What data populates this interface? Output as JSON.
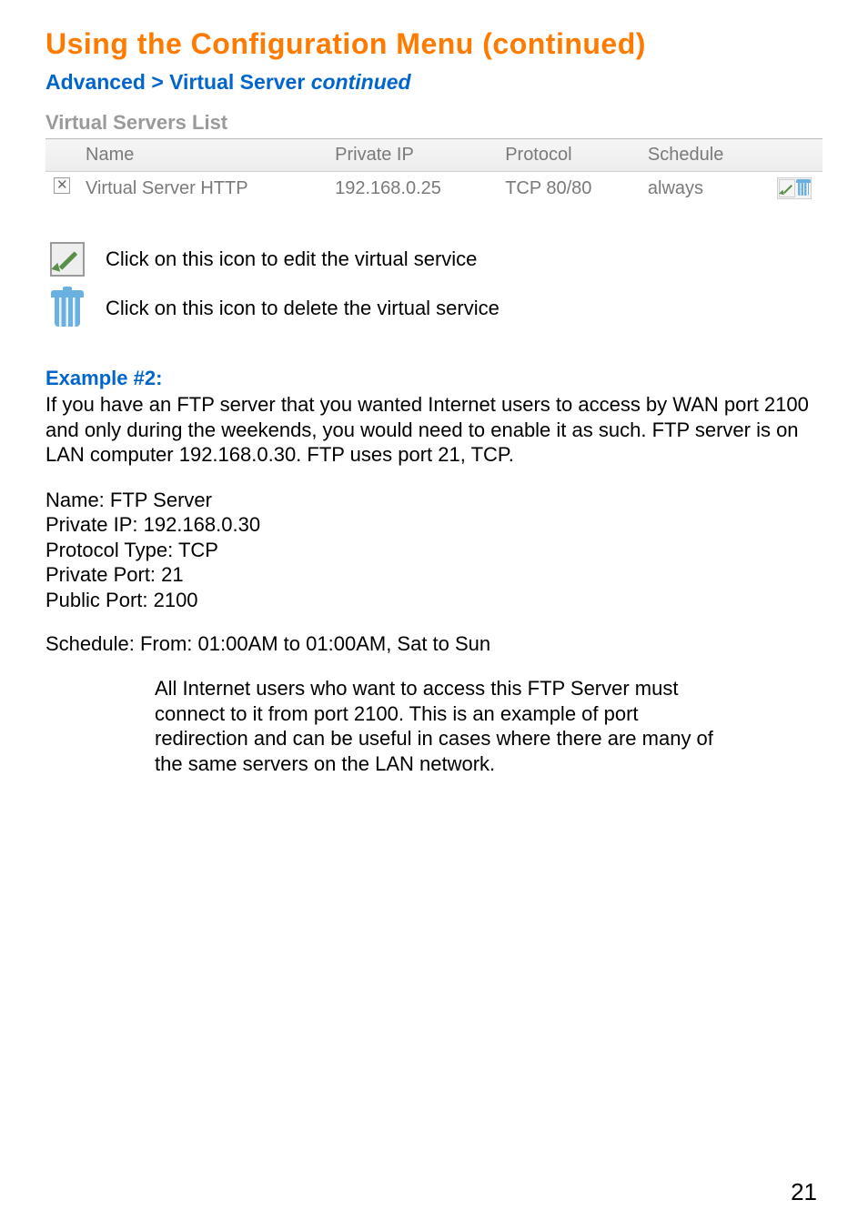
{
  "title": "Using the Configuration Menu (continued)",
  "breadcrumb": {
    "path": "Advanced > Virtual Server ",
    "suffix": "continued"
  },
  "vs_list": {
    "heading": "Virtual Servers List",
    "headers": {
      "name": "Name",
      "private_ip": "Private IP",
      "protocol": "Protocol",
      "schedule": "Schedule"
    },
    "rows": [
      {
        "checked": true,
        "name": "Virtual Server HTTP",
        "private_ip": "192.168.0.25",
        "protocol": "TCP 80/80",
        "schedule": "always"
      }
    ]
  },
  "legend": {
    "edit": "Click on this icon to edit the virtual service",
    "delete": "Click on this icon to delete the virtual service"
  },
  "example": {
    "heading": "Example #2:",
    "para": "If you have an FTP server that you wanted Internet users to access by WAN port 2100 and only during the weekends, you would need to enable it as such. FTP server is on LAN computer 192.168.0.30. FTP uses port 21, TCP.",
    "config": {
      "name": "Name: FTP Server",
      "private_ip": "Private IP: 192.168.0.30",
      "protocol": "Protocol Type: TCP",
      "private_port": "Private Port: 21",
      "public_port": "Public Port: 2100"
    },
    "schedule": "Schedule: From: 01:00AM to 01:00AM, Sat to Sun",
    "note": "All Internet users who want to access this FTP Server must connect to it from port 2100. This is an example of port redirection and can be useful in cases where there are many of the same servers on the LAN network."
  },
  "page_number": "21"
}
